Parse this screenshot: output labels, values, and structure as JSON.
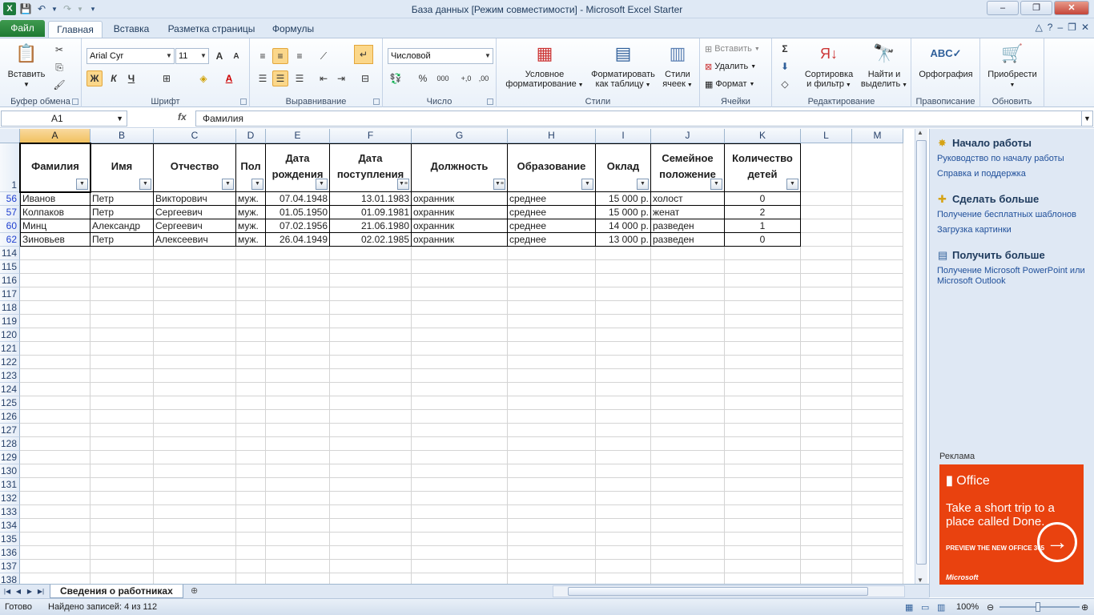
{
  "window": {
    "title": "База данных  [Режим совместимости]  -  Microsoft Excel Starter",
    "minimize": "–",
    "restore": "❐",
    "close": "✕"
  },
  "tabs": {
    "file": "Файл",
    "home": "Главная",
    "insert": "Вставка",
    "page_layout": "Разметка страницы",
    "formulas": "Формулы"
  },
  "ribbon": {
    "clipboard": {
      "label": "Буфер обмена",
      "paste": "Вставить"
    },
    "font": {
      "label": "Шрифт",
      "font_name": "Arial Cyr",
      "font_size": "11",
      "bold": "Ж",
      "italic": "К",
      "underline": "Ч",
      "grow": "A",
      "shrink": "A"
    },
    "alignment": {
      "label": "Выравнивание"
    },
    "number": {
      "label": "Число",
      "format": "Числовой",
      "percent": "%",
      "thousands": "000",
      "inc_dec": "+,0",
      "dec_dec": ",00"
    },
    "styles": {
      "label": "Стили",
      "cond_format_1": "Условное",
      "cond_format_2": "форматирование",
      "as_table_1": "Форматировать",
      "as_table_2": "как таблицу",
      "cell_styles_1": "Стили",
      "cell_styles_2": "ячеек"
    },
    "cells": {
      "label": "Ячейки",
      "insert": "Вставить",
      "delete": "Удалить",
      "format": "Формат"
    },
    "editing": {
      "label": "Редактирование",
      "sort_1": "Сортировка",
      "sort_2": "и фильтр",
      "find_1": "Найти и",
      "find_2": "выделить"
    },
    "proofing": {
      "label": "Правописание",
      "spelling": "Орфография"
    },
    "update": {
      "label": "Обновить",
      "upgrade": "Приобрести"
    }
  },
  "formula_bar": {
    "name_box": "A1",
    "fx": "fx",
    "content": "Фамилия"
  },
  "columns": [
    "A",
    "B",
    "C",
    "D",
    "E",
    "F",
    "G",
    "H",
    "I",
    "J",
    "K",
    "L",
    "M"
  ],
  "header_row_number": "1",
  "headers": [
    "Фамилия",
    "Имя",
    "Отчество",
    "Пол",
    "Дата рождения",
    "Дата поступления",
    "Должность",
    "Образование",
    "Оклад",
    "Семейное положение",
    "Количество детей"
  ],
  "data_rows": [
    {
      "row": "56",
      "cells": [
        "Иванов",
        "Петр",
        "Викторович",
        "муж.",
        "07.04.1948",
        "13.01.1983",
        "охранник",
        "среднее",
        "15 000 р.",
        "холост",
        "0"
      ]
    },
    {
      "row": "57",
      "cells": [
        "Колпаков",
        "Петр",
        "Сергеевич",
        "муж.",
        "01.05.1950",
        "01.09.1981",
        "охранник",
        "среднее",
        "15 000 р.",
        "женат",
        "2"
      ]
    },
    {
      "row": "60",
      "cells": [
        "Минц",
        "Александр",
        "Сергеевич",
        "муж.",
        "07.02.1956",
        "21.06.1980",
        "охранник",
        "среднее",
        "14 000 р.",
        "разведен",
        "1"
      ]
    },
    {
      "row": "62",
      "cells": [
        "Зиновьев",
        "Петр",
        "Алексеевич",
        "муж.",
        "26.04.1949",
        "02.02.1985",
        "охранник",
        "среднее",
        "13 000 р.",
        "разведен",
        "0"
      ]
    }
  ],
  "empty_rows": [
    "114",
    "115",
    "116",
    "117",
    "118",
    "119",
    "120",
    "121",
    "122",
    "123",
    "124",
    "125",
    "126",
    "127",
    "128",
    "129",
    "130",
    "131",
    "132",
    "133",
    "134",
    "135",
    "136",
    "137",
    "138"
  ],
  "task_pane": {
    "s1_title": "Начало работы",
    "s1_link1": "Руководство по началу работы",
    "s1_link2": "Справка и поддержка",
    "s2_title": "Сделать больше",
    "s2_link1": "Получение бесплатных шаблонов",
    "s2_link2": "Загрузка картинки",
    "s3_title": "Получить больше",
    "s3_link1": "Получение Microsoft PowerPoint или Microsoft Outlook",
    "ad_label": "Реклама",
    "ad_logo": "Office",
    "ad_tagline": "Take a short trip to a place called Done.",
    "ad_preview": "PREVIEW THE NEW OFFICE 365",
    "ad_brand": "Microsoft"
  },
  "sheet_tab": "Сведения о работниках",
  "status": {
    "ready": "Готово",
    "found": "Найдено записей: 4 из 112",
    "zoom": "100%"
  },
  "colors": {
    "accent": "#1f7a32",
    "selection": "#f1c15f",
    "ad": "#e9420f"
  }
}
